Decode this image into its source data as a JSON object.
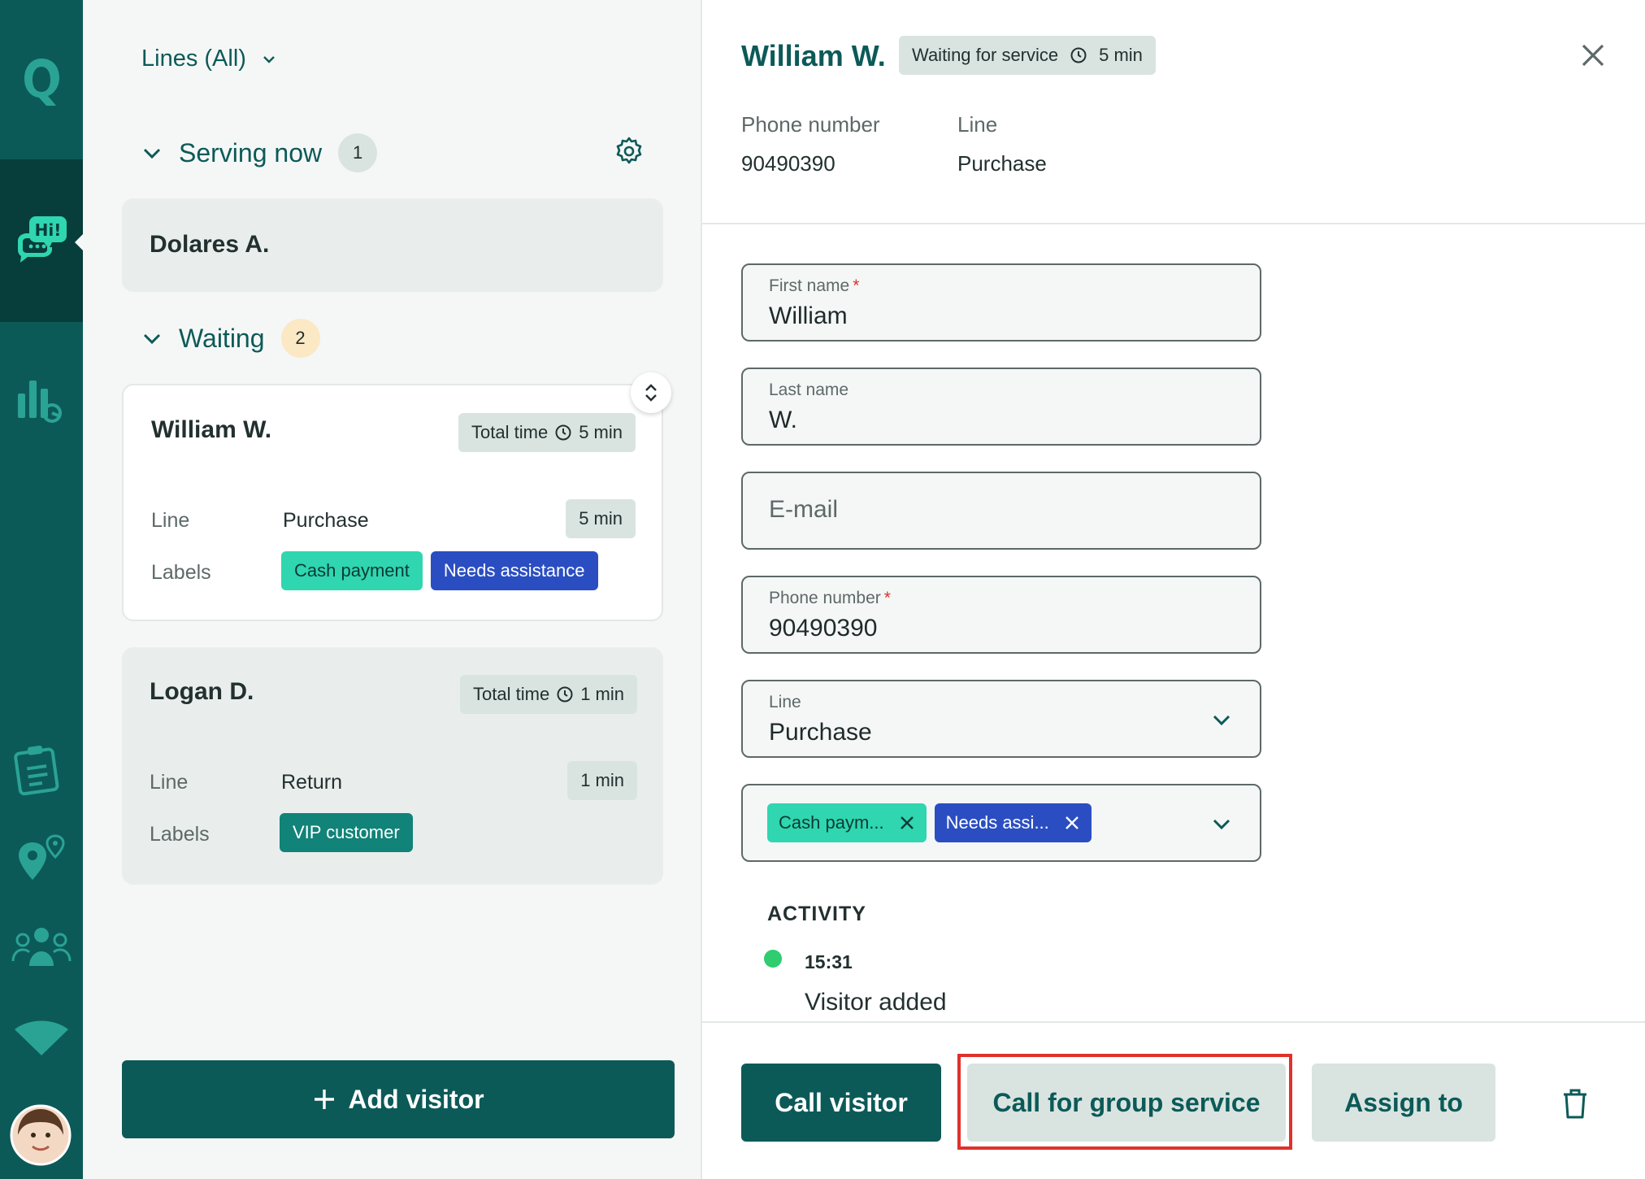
{
  "colors": {
    "primary": "#0c5a58",
    "rail": "#0c5a58",
    "tag_cash": "#2fd6b0",
    "tag_assist": "#2a4ec2",
    "tag_vip": "#118378",
    "highlight": "#e0312b"
  },
  "nav": {
    "logo_icon": "q-logo-icon",
    "items": [
      "chat-hi-icon",
      "analytics-icon",
      "clipboard-icon",
      "map-pin-icon",
      "users-icon",
      "wifi-icon"
    ],
    "avatar_icon": "user-avatar"
  },
  "queue": {
    "lines_filter": "Lines (All)",
    "serving": {
      "title": "Serving now",
      "count": "1",
      "visitor": "Dolares A."
    },
    "waiting": {
      "title": "Waiting",
      "count": "2",
      "visitors": [
        {
          "name": "William W.",
          "total_time_label": "Total time",
          "total_time": "5 min",
          "line_label": "Line",
          "line": "Purchase",
          "line_time": "5 min",
          "labels_label": "Labels",
          "labels": [
            "Cash payment",
            "Needs assistance"
          ]
        },
        {
          "name": "Logan D.",
          "total_time_label": "Total time",
          "total_time": "1 min",
          "line_label": "Line",
          "line": "Return",
          "line_time": "1 min",
          "labels_label": "Labels",
          "labels": [
            "VIP customer"
          ]
        }
      ]
    },
    "add_visitor": "Add visitor"
  },
  "detail": {
    "name": "William W.",
    "status": "Waiting for service",
    "status_time": "5 min",
    "phone_label": "Phone number",
    "phone": "90490390",
    "line_label": "Line",
    "line": "Purchase",
    "form": {
      "first_name": {
        "label": "First name",
        "required": "*",
        "value": "William"
      },
      "last_name": {
        "label": "Last name",
        "value": "W."
      },
      "email": {
        "placeholder": "E-mail"
      },
      "phone": {
        "label": "Phone number",
        "required": "*",
        "value": "90490390"
      },
      "line": {
        "label": "Line",
        "value": "Purchase"
      },
      "labels": [
        "Cash paym...",
        "Needs assi..."
      ]
    },
    "activity": {
      "title": "ACTIVITY",
      "entries": [
        {
          "time": "15:31",
          "text": "Visitor added"
        }
      ]
    },
    "actions": {
      "call_visitor": "Call visitor",
      "call_group": "Call for group service",
      "assign_to": "Assign to"
    }
  }
}
